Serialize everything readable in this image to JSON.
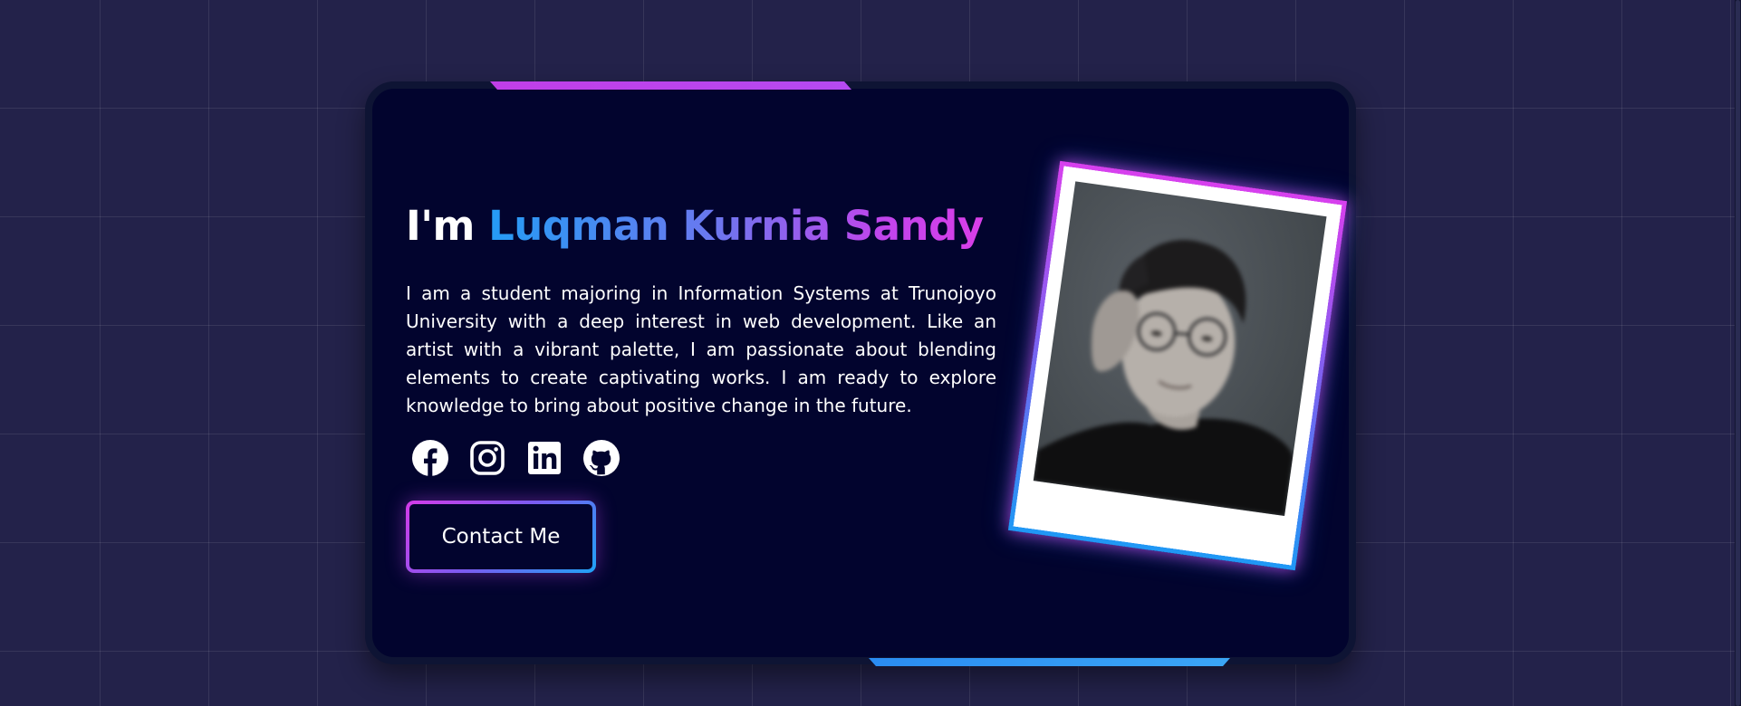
{
  "hero": {
    "greeting": "I'm",
    "name": "Luqman Kurnia Sandy",
    "bio": "I am a student majoring in Information Systems at Trunojoyo University with a deep interest in web development. Like an artist with a vibrant palette, I am passionate about blending elements to create captivating works. I am ready to explore knowledge to bring about positive change in the future.",
    "contact_label": "Contact Me"
  },
  "socials": [
    {
      "icon": "facebook-icon"
    },
    {
      "icon": "instagram-icon"
    },
    {
      "icon": "linkedin-icon"
    },
    {
      "icon": "github-icon"
    }
  ],
  "colors": {
    "page_background": "#23224a",
    "card_background": "#02042e",
    "accent_pink": "#d83ee8",
    "accent_blue": "#249cf5",
    "text": "#ffffff"
  }
}
